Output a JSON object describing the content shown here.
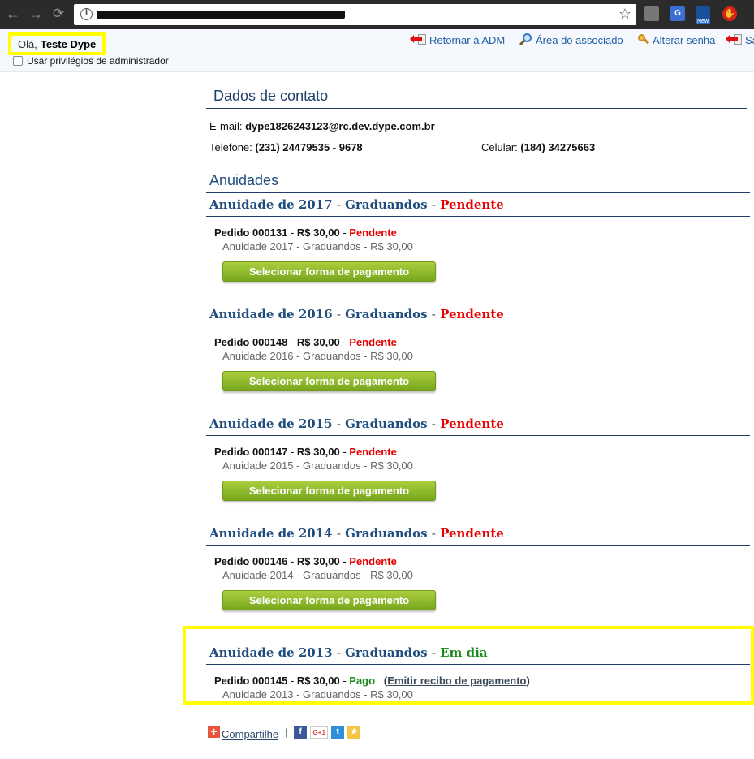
{
  "browser": {
    "url_redacted": true,
    "icons": [
      "back-arrow-icon",
      "forward-arrow-icon",
      "reload-icon",
      "info-icon",
      "bookmark-star-icon"
    ],
    "extension_badge_new": "New"
  },
  "topbar": {
    "greeting_prefix": "Olá,",
    "greeting_name": "Teste Dype",
    "admin_privileges_label": "Usar privilégios de administrador",
    "links": {
      "return_adm": "Retornar à ADM",
      "member_area": "Área do associado",
      "change_password": "Alterar senha",
      "logout_partial": "Sa"
    }
  },
  "contact": {
    "title": "Dados de contato",
    "email_label": "E-mail:",
    "email_value": "dype1826243123@rc.dev.dype.com.br",
    "phone_label": "Telefone:",
    "phone_value": "(231) 24479535 - 9678",
    "mobile_label": "Celular:",
    "mobile_value": "(184) 34275663"
  },
  "annuities": {
    "title": "Anuidades",
    "dash": "-",
    "button_label": "Selecionar forma de pagamento",
    "groups": [
      {
        "year_title": "Anuidade de 2017",
        "category": "Graduandos",
        "status": "Pendente",
        "order": "Pedido 000131",
        "amount": "R$ 30,00",
        "order_status": "Pendente",
        "detail": "Anuidade 2017 - Graduandos - R$ 30,00"
      },
      {
        "year_title": "Anuidade de 2016",
        "category": "Graduandos",
        "status": "Pendente",
        "order": "Pedido 000148",
        "amount": "R$ 30,00",
        "order_status": "Pendente",
        "detail": "Anuidade 2016 - Graduandos - R$ 30,00"
      },
      {
        "year_title": "Anuidade de 2015",
        "category": "Graduandos",
        "status": "Pendente",
        "order": "Pedido 000147",
        "amount": "R$ 30,00",
        "order_status": "Pendente",
        "detail": "Anuidade 2015 - Graduandos - R$ 30,00"
      },
      {
        "year_title": "Anuidade de 2014",
        "category": "Graduandos",
        "status": "Pendente",
        "order": "Pedido 000146",
        "amount": "R$ 30,00",
        "order_status": "Pendente",
        "detail": "Anuidade 2014 - Graduandos - R$ 30,00"
      },
      {
        "year_title": "Anuidade de 2013",
        "category": "Graduandos",
        "status": "Em dia",
        "order": "Pedido 000145",
        "amount": "R$ 30,00",
        "order_status": "Pago",
        "receipt_link": "Emitir recibo de pagamento",
        "detail": "Anuidade 2013 - Graduandos - R$ 30,00"
      }
    ]
  },
  "share": {
    "label": "Compartilhe",
    "separator": "|",
    "plus_glyph": "+",
    "facebook_glyph": "f",
    "googleplus_glyph": "G+1",
    "twitter_glyph": "t",
    "favorite_glyph": "★"
  },
  "colors": {
    "accent_blue": "#1f4d7e",
    "pending_red": "#e60000",
    "paid_green": "#1a8a1a",
    "button_green": "#8dbb2c",
    "highlight_yellow": "#ffff00"
  }
}
